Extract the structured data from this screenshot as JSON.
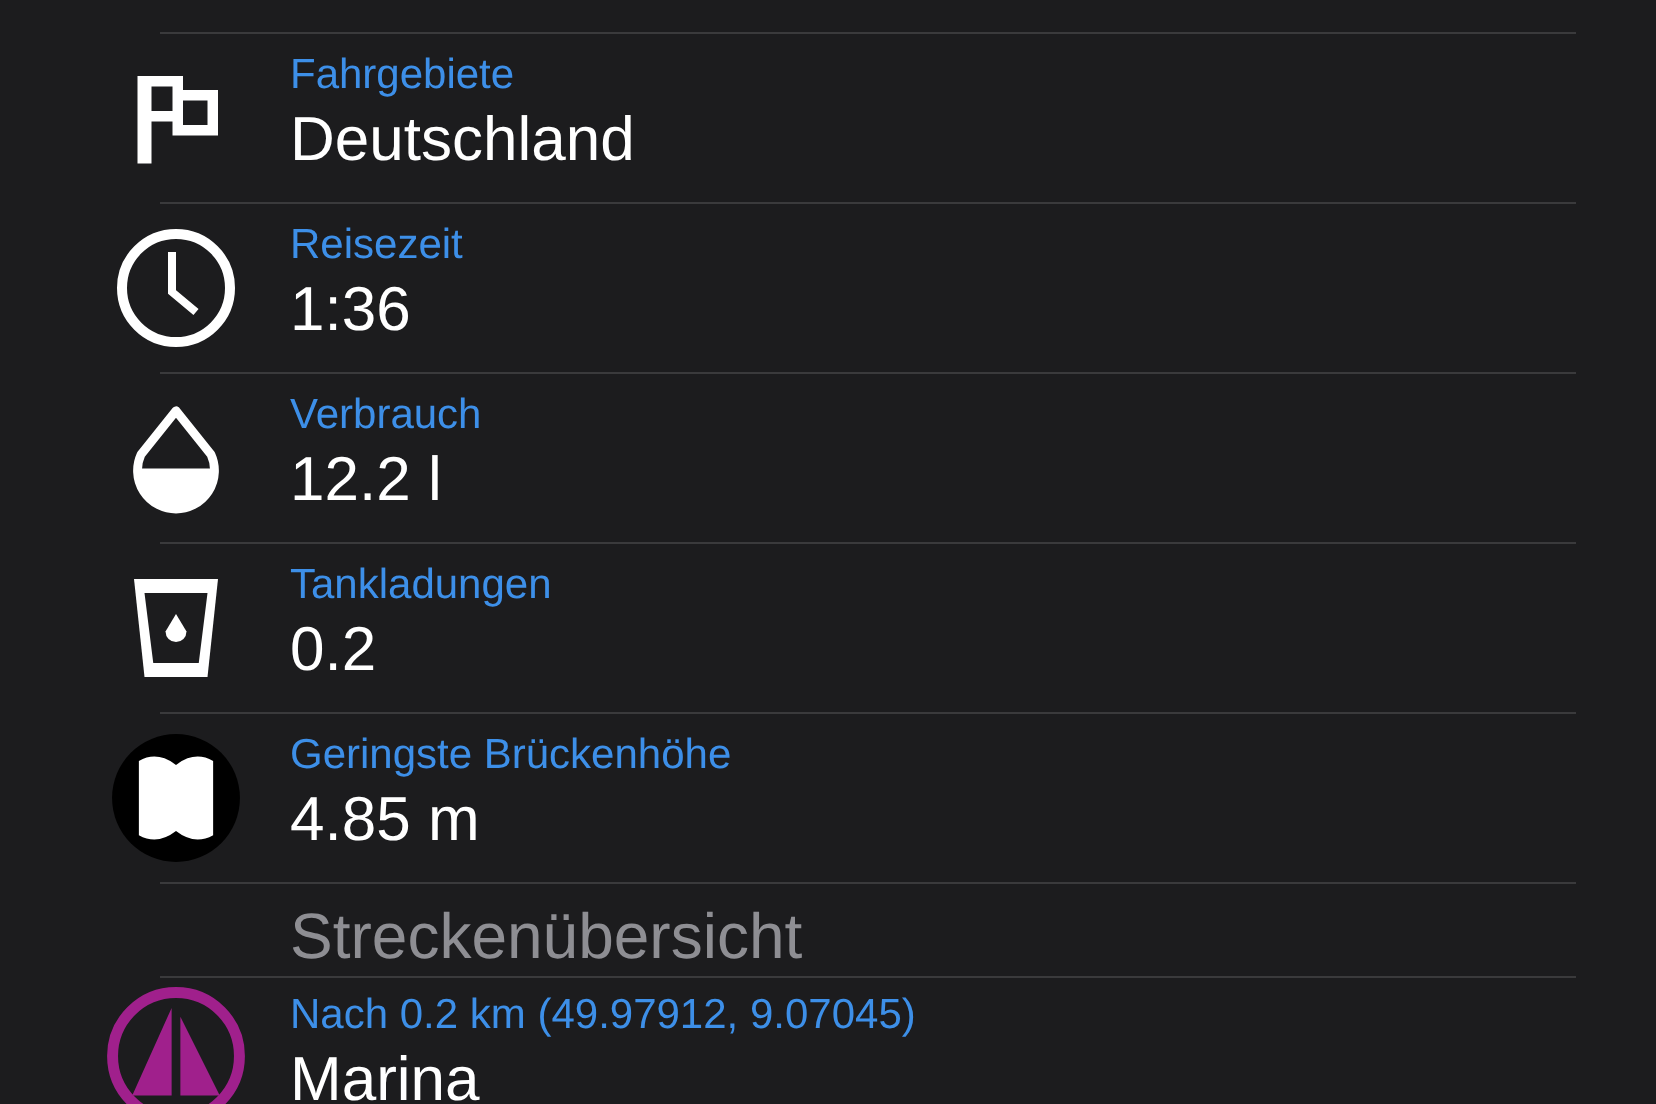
{
  "stats": [
    {
      "kind": "flag",
      "label": "Fahrgebiete",
      "value": "Deutschland"
    },
    {
      "kind": "clock",
      "label": "Reisezeit",
      "value": "1:36"
    },
    {
      "kind": "drop",
      "label": "Verbrauch",
      "value": "12.2 l"
    },
    {
      "kind": "tank",
      "label": "Tankladungen",
      "value": "0.2"
    },
    {
      "kind": "bridge",
      "label": "Geringste Brückenhöhe",
      "value": "4.85 m"
    }
  ],
  "section_title": "Streckenübersicht",
  "waypoints": [
    {
      "kind": "marina",
      "label": "Nach 0.2 km (49.97912, 9.07045)",
      "value": "Marina"
    }
  ]
}
